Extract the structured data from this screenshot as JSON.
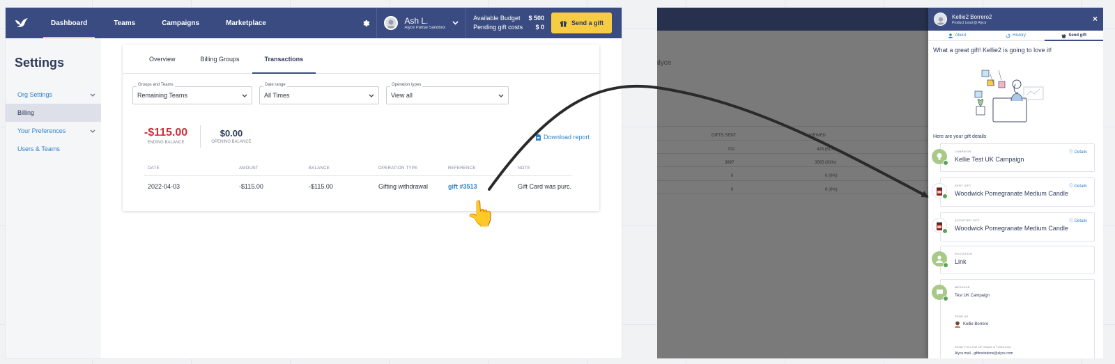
{
  "left_app": {
    "nav": {
      "items": [
        {
          "label": "Dashboard",
          "active": true
        },
        {
          "label": "Teams"
        },
        {
          "label": "Campaigns"
        },
        {
          "label": "Marketplace"
        }
      ]
    },
    "user": {
      "name": "Ash L.",
      "subtitle": "Alyce Partial Sandbox"
    },
    "budget": {
      "available_label": "Available Budget",
      "available_value": "$ 500",
      "pending_label": "Pending gift costs",
      "pending_value": "$ 0"
    },
    "send_gift_label": "Send a gift",
    "sidebar": {
      "title": "Settings",
      "items": [
        {
          "label": "Org Settings",
          "expandable": true
        },
        {
          "label": "Billing",
          "active": true
        },
        {
          "label": "Your Preferences",
          "expandable": true
        },
        {
          "label": "Users & Teams"
        }
      ]
    },
    "tabs": [
      "Overview",
      "Billing Groups",
      "Transactions"
    ],
    "filters": {
      "groups": {
        "label": "Groups and Teams",
        "value": "Remaining Teams"
      },
      "date": {
        "label": "Date range",
        "value": "All Times"
      },
      "operation": {
        "label": "Operation types",
        "value": "View all"
      }
    },
    "balances": {
      "ending": {
        "value": "-$115.00",
        "caption": "ENDING BALANCE"
      },
      "opening": {
        "value": "$0.00",
        "caption": "OPENING BALANCE"
      }
    },
    "download_label": "Download report",
    "table": {
      "columns": [
        "DATE",
        "AMOUNT",
        "BALANCE",
        "OPERATION TYPE",
        "REFERENCE",
        "NOTE"
      ],
      "rows": [
        {
          "date": "2022-04-03",
          "amount": "-$115.00",
          "balance": "-$115.00",
          "type": "Gifting withdrawal",
          "reference": "gift #3513",
          "note": "Gift Card was purc..."
        }
      ]
    },
    "hand_emoji": "👆"
  },
  "right_app": {
    "bg_text": {
      "brand_fragment": "alyce",
      "col1": "GIFTS SENT",
      "col2": "VIEWED",
      "rows": [
        {
          "a": "702",
          "b": "428 (61%)"
        },
        {
          "a": "3897",
          "b": "3565 (91%)"
        },
        {
          "a": "0",
          "b": "0 (0%)"
        },
        {
          "a": "0",
          "b": "0 (0%)"
        }
      ]
    },
    "drawer": {
      "name": "Kellie2 Borrero2",
      "subtitle": "Product Lead @ Alyce",
      "close": "×",
      "tabs": [
        {
          "label": "About"
        },
        {
          "label": "History"
        },
        {
          "label": "Send gift",
          "active": true
        }
      ],
      "headline": "What a great gift! Kellie2 is going to love it!",
      "details_title": "Here are your gift details",
      "cards": {
        "campaign": {
          "caption": "CAMPAIGN",
          "value": "Kellie Test UK Campaign",
          "details": "Details"
        },
        "sent_gift": {
          "caption": "SENT GIFT",
          "value": "Woodwick Pomegranate Medium Candle",
          "details": "Details"
        },
        "accepted_gift": {
          "caption": "ACCEPTED GIFT",
          "value": "Woodwick Pomegranate Medium Candle",
          "details": "Details"
        },
        "invitation": {
          "caption": "INVITATION",
          "value": "Link"
        },
        "message": {
          "caption": "MESSAGE",
          "value": "Test UK Campaign",
          "send_as_caption": "SEND AS",
          "send_as_value": "Kellie Borrero",
          "followup_caption": "SEND FOLLOW UP EMAILS THROUGH",
          "followup_value": "Alyce mail - giftinvitations@alyce.com"
        }
      }
    }
  },
  "colors": {
    "navy": "#394b80",
    "accent_yellow": "#f6cc45",
    "negative_red": "#c8303a",
    "link_blue": "#2f82c8"
  }
}
